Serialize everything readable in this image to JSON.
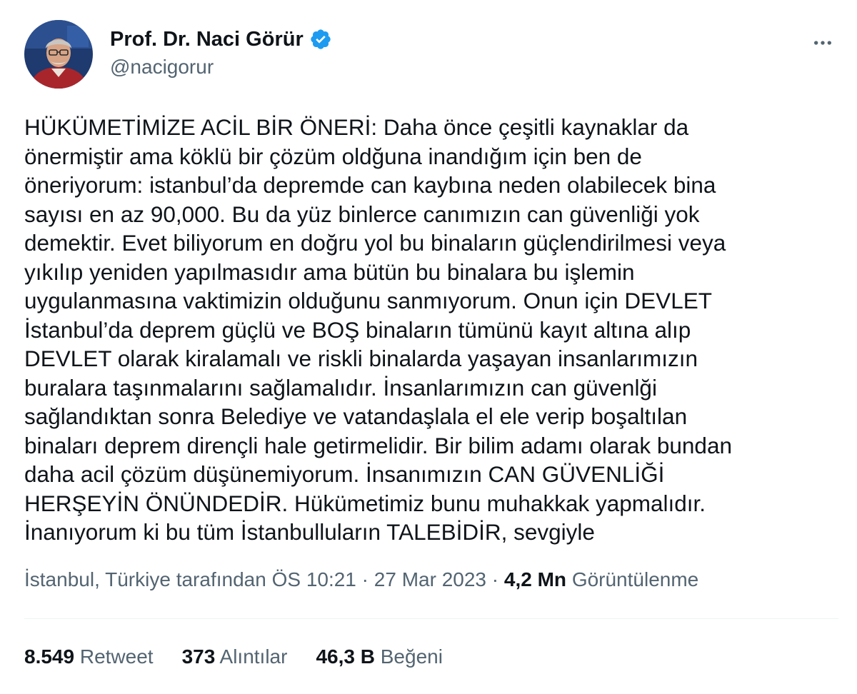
{
  "author": {
    "name": "Prof. Dr. Naci Görür",
    "handle": "@nacigorur",
    "verified_color": "#1d9bf0"
  },
  "icons": {
    "verified": "verified-badge-icon",
    "more": "more-options-icon"
  },
  "tweet": {
    "lines": [
      "HÜKÜMETİMİZE ACİL BİR ÖNERİ: Daha önce çeşitli kaynaklar da",
      "önermiştir ama köklü bir çözüm oldğuna inandığım için ben de",
      "öneriyorum: istanbul’da depremde can kaybına neden olabilecek bina",
      "sayısı en az 90,000. Bu da yüz binlerce canımızın can güvenliği yok",
      "demektir. Evet biliyorum en doğru yol bu binaların güçlendirilmesi veya",
      "yıkılıp yeniden yapılmasıdır ama bütün bu binalara bu işlemin",
      "uygulanmasına vaktimizin olduğunu sanmıyorum. Onun için DEVLET",
      "İstanbul’da deprem güçlü ve BOŞ binaların tümünü kayıt altına alıp",
      "DEVLET olarak kiralamalı ve riskli binalarda yaşayan insanlarımızın",
      "buralara taşınmalarını sağlamalıdır. İnsanlarımızın can güvenlği",
      "sağlandıktan sonra Belediye ve vatandaşlala el ele verip boşaltılan",
      "binaları deprem dirençli hale getirmelidir. Bir bilim adamı olarak bundan",
      "daha acil çözüm düşünemiyorum. İnsanımızın CAN GÜVENLİĞİ",
      "HERŞEYİN ÖNÜNDEDİR. Hükümetimiz bunu muhakkak yapmalıdır.",
      "İnanıyorum ki bu tüm İstanbulluların TALEBİDİR, sevgiyle"
    ]
  },
  "meta": {
    "location": "İstanbul, Türkiye tarafından",
    "time": "ÖS 10:21",
    "separator": " · ",
    "date": "27 Mar 2023",
    "views_count": "4,2 Mn",
    "views_label": "Görüntülenme"
  },
  "stats": {
    "retweets": {
      "count": "8.549",
      "label": "Retweet"
    },
    "quotes": {
      "count": "373",
      "label": "Alıntılar"
    },
    "likes": {
      "count": "46,3 B",
      "label": "Beğeni"
    }
  }
}
